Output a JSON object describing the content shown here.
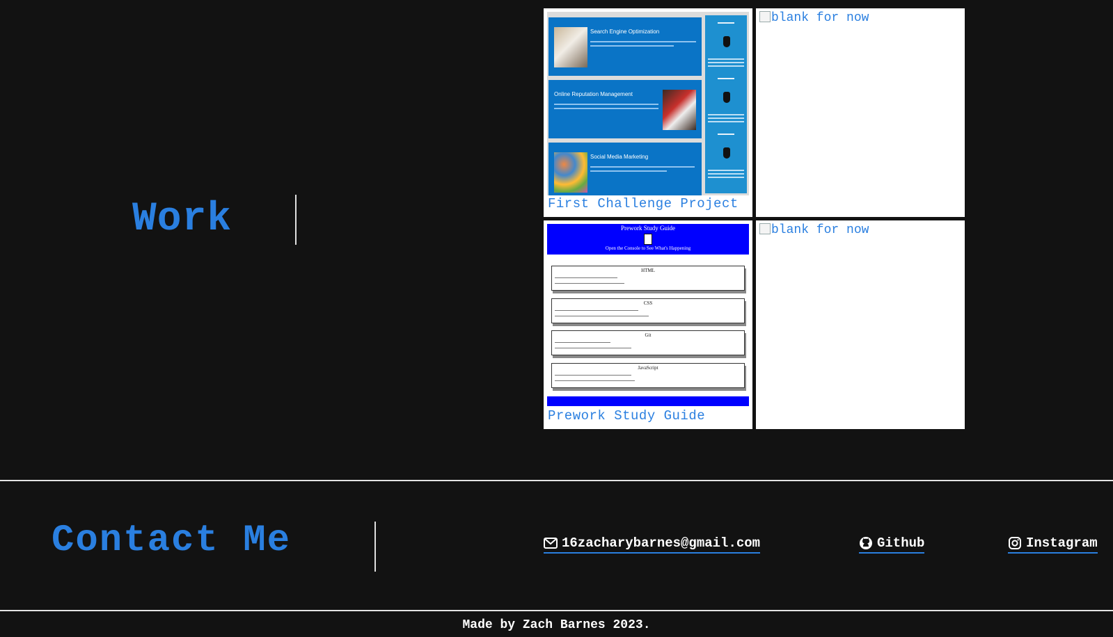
{
  "work": {
    "title": "Work",
    "projects": [
      {
        "label": "First Challenge Project"
      },
      {
        "broken_image_alt": "blank for now"
      },
      {
        "label": "Prework Study Guide"
      },
      {
        "broken_image_alt": "blank for now"
      }
    ],
    "first_project_thumbnail": {
      "panels": [
        "Search Engine Optimization",
        "Online Reputation Management",
        "Social Media Marketing"
      ],
      "sidebar": [
        "Lead Generation",
        "Brand Awareness",
        "Cost Management"
      ]
    },
    "prework_thumbnail": {
      "title": "Prework Study Guide",
      "subtitle": "Open the Console to See What's Happening",
      "sections": [
        "HTML",
        "CSS",
        "Git",
        "JavaScript"
      ]
    }
  },
  "contact": {
    "title": "Contact Me",
    "links": [
      {
        "label": "16zacharybarnes@gmail.com",
        "icon": "envelope-icon"
      },
      {
        "label": "Github",
        "icon": "github-icon"
      },
      {
        "label": "Instagram",
        "icon": "instagram-icon"
      }
    ]
  },
  "footer": {
    "text": "Made by Zach Barnes 2023."
  },
  "colors": {
    "background": "#121212",
    "accent": "#2a7fe0",
    "text": "#ffffff"
  }
}
